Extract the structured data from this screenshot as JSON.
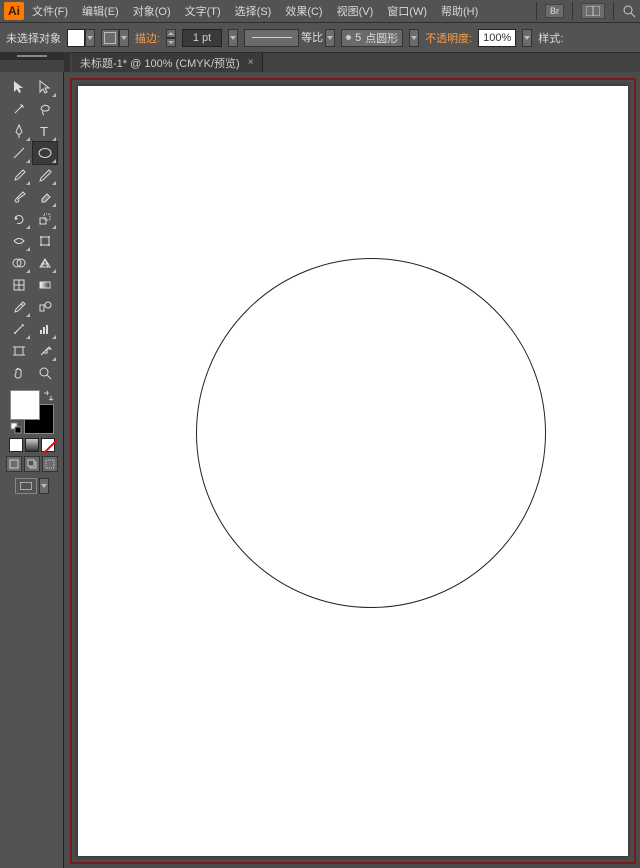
{
  "logo": "Ai",
  "menus": {
    "file": "文件(F)",
    "edit": "编辑(E)",
    "object": "对象(O)",
    "type": "文字(T)",
    "select": "选择(S)",
    "effect": "效果(C)",
    "view": "视图(V)",
    "window": "窗口(W)",
    "help": "帮助(H)"
  },
  "bridge_btn": "Br",
  "control": {
    "selection_status": "未选择对象",
    "stroke_label": "描边:",
    "stroke_weight": "1 pt",
    "ratio": "等比",
    "brush_size": "5",
    "brush_name": "点圆形",
    "opacity_label": "不透明度:",
    "opacity_value": "100%",
    "style_label": "样式:"
  },
  "doc_tab": {
    "title": "未标题-1* @ 100% (CMYK/预览)",
    "close": "×"
  },
  "tools": {
    "names": [
      "selection-tool",
      "direct-selection-tool",
      "magic-wand-tool",
      "lasso-tool",
      "pen-tool",
      "type-tool",
      "line-tool",
      "ellipse-tool",
      "paintbrush-tool",
      "pencil-tool",
      "blob-brush-tool",
      "eraser-tool",
      "rotate-tool",
      "scale-tool",
      "width-tool",
      "free-transform-tool",
      "shape-builder-tool",
      "perspective-grid-tool",
      "mesh-tool",
      "gradient-tool",
      "eyedropper-tool",
      "blend-tool",
      "symbol-sprayer-tool",
      "column-graph-tool",
      "artboard-tool",
      "slice-tool",
      "hand-tool",
      "zoom-tool"
    ]
  },
  "canvas": {
    "shape": "circle"
  }
}
